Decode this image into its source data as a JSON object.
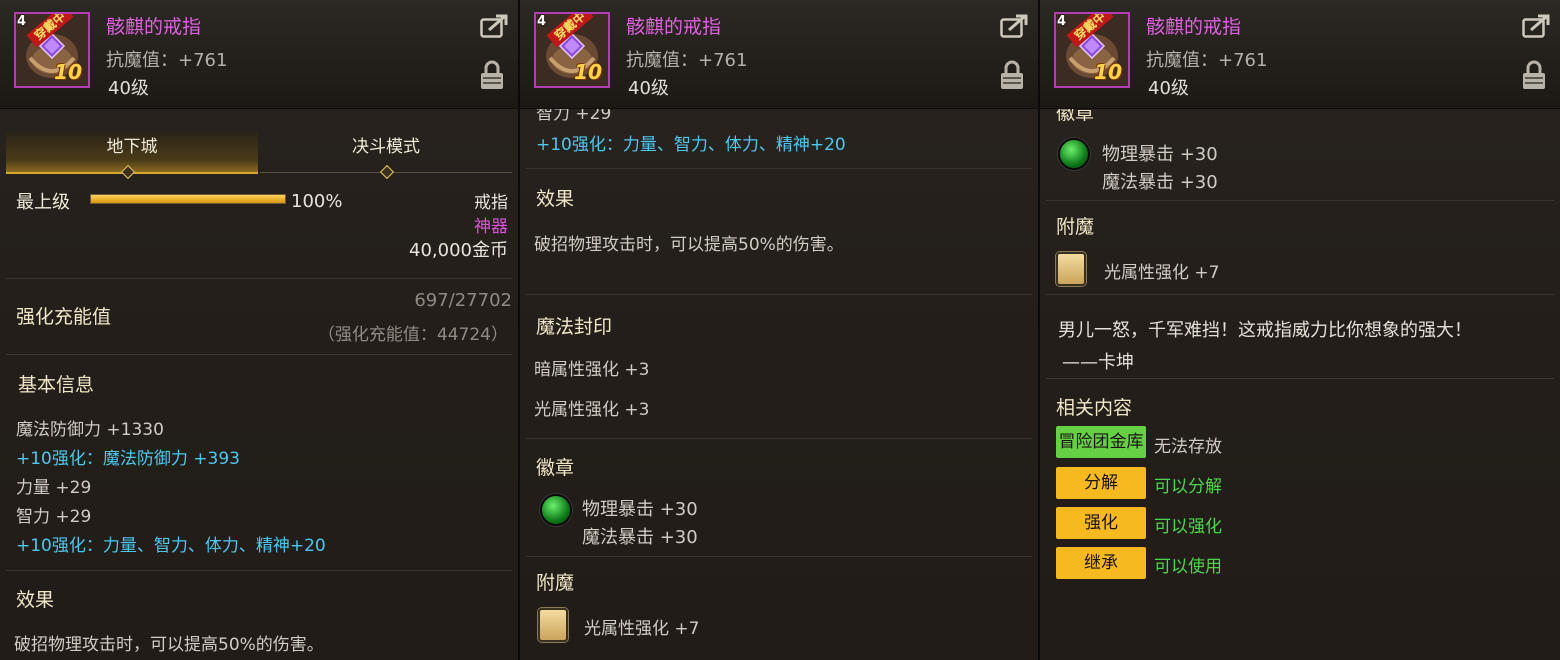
{
  "item": {
    "name": "骸麒的戒指",
    "stat_line": "抗魔值：+761",
    "level": "40级",
    "icon_level": "4",
    "equipped_tag": "穿戴中",
    "upgrade_badge": "10",
    "icon_name": "ring-item-icon"
  },
  "tabs": [
    "地下城",
    "决斗模式"
  ],
  "grade": {
    "label": "最上级",
    "percent_text": "100%",
    "percent_value": 100,
    "type": "戒指",
    "rarity": "神器",
    "price": "40,000金币"
  },
  "enhance_energy": {
    "title": "强化充能值",
    "progress": "697/27702",
    "note": "（强化充能值：44724）"
  },
  "basic_info": {
    "title": "基本信息",
    "lines": [
      {
        "text": "魔法防御力 +1330",
        "tone": "normal"
      },
      {
        "text": "+10强化：魔法防御力 +393",
        "tone": "cyan"
      },
      {
        "text": "力量 +29",
        "tone": "normal"
      },
      {
        "text": "智力 +29",
        "tone": "normal"
      },
      {
        "text": "+10强化：力量、智力、体力、精神+20",
        "tone": "cyan"
      }
    ],
    "partial_line": "智力 +29"
  },
  "effect": {
    "title": "效果",
    "text": "破招物理攻击时，可以提高50%的伤害。"
  },
  "magic_seal": {
    "title": "魔法封印",
    "lines": [
      "暗属性强化 +3",
      "光属性强化 +3"
    ]
  },
  "emblem": {
    "title": "徽章",
    "lines": [
      "物理暴击 +30",
      "魔法暴击 +30"
    ]
  },
  "enchant": {
    "title": "附魔",
    "text": "光属性强化 +7"
  },
  "flavor": {
    "quote": "男儿一怒，千军难挡！这戒指威力比你想象的强大！",
    "author": "——卡坤"
  },
  "related": {
    "title": "相关内容",
    "rows": [
      {
        "button": "冒险团金库",
        "status": "无法存放",
        "button_color": "green",
        "status_tone": "normal"
      },
      {
        "button": "分解",
        "status": "可以分解",
        "button_color": "yellow",
        "status_tone": "green"
      },
      {
        "button": "强化",
        "status": "可以强化",
        "button_color": "yellow",
        "status_tone": "green"
      },
      {
        "button": "继承",
        "status": "可以使用",
        "button_color": "yellow",
        "status_tone": "green"
      }
    ]
  },
  "colors": {
    "item_name": "#e060e0",
    "enhance_cyan": "#4cc8f0",
    "rarity_magenta": "#e050e0",
    "status_green": "#4cd64c",
    "button_yellow": "#f6b920",
    "button_green": "#66d044",
    "grade_bar": "#f0b020"
  }
}
